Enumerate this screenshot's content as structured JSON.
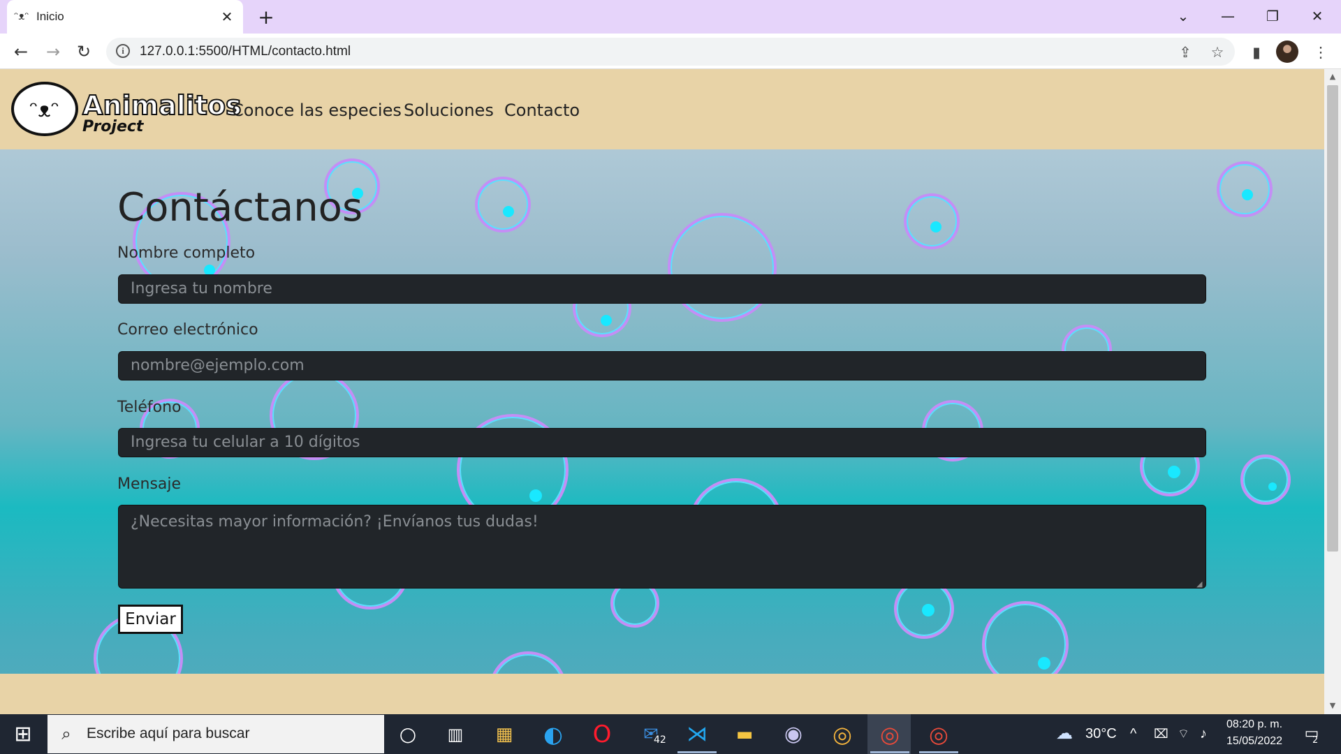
{
  "browser": {
    "tab_title": "Inicio",
    "tab_close": "✕",
    "new_tab": "+",
    "url": "127.0.0.1:5500/HTML/contacto.html",
    "controls": {
      "tab_search": "⌄",
      "minimize": "—",
      "restore": "❐",
      "close": "✕"
    },
    "nav": {
      "back": "←",
      "forward": "→",
      "reload": "↻"
    },
    "icons": {
      "share": "⇪",
      "bookmark": "☆",
      "sidepanel": "▮",
      "menu": "⋮",
      "info": "i"
    }
  },
  "site": {
    "logo_title": "Animalitos",
    "logo_subtitle": "Project",
    "logo_face": "ᵔᴥᵔ",
    "nav": [
      "Conoce las especies",
      "Soluciones",
      "Contacto"
    ]
  },
  "form": {
    "heading": "Contáctanos",
    "name_label": "Nombre completo",
    "name_placeholder": "Ingresa tu nombre",
    "email_label": "Correo electrónico",
    "email_placeholder": "nombre@ejemplo.com",
    "phone_label": "Teléfono",
    "phone_placeholder": "Ingresa tu celular a 10 dígitos",
    "message_label": "Mensaje",
    "message_placeholder": "¿Necesitas mayor información? ¡Envíanos tus dudas!",
    "submit_label": "Enviar"
  },
  "taskbar": {
    "search_placeholder": "Escribe aquí para buscar",
    "mail_badge": "42",
    "weather": "30°C",
    "time": "08:20 p. m.",
    "date": "15/05/2022",
    "notifications": "2"
  },
  "colors": {
    "header_bg": "#e8d3a7",
    "field_bg": "#212529",
    "bubble": "#c48ef5",
    "bubble_dot": "#19e8ff"
  }
}
